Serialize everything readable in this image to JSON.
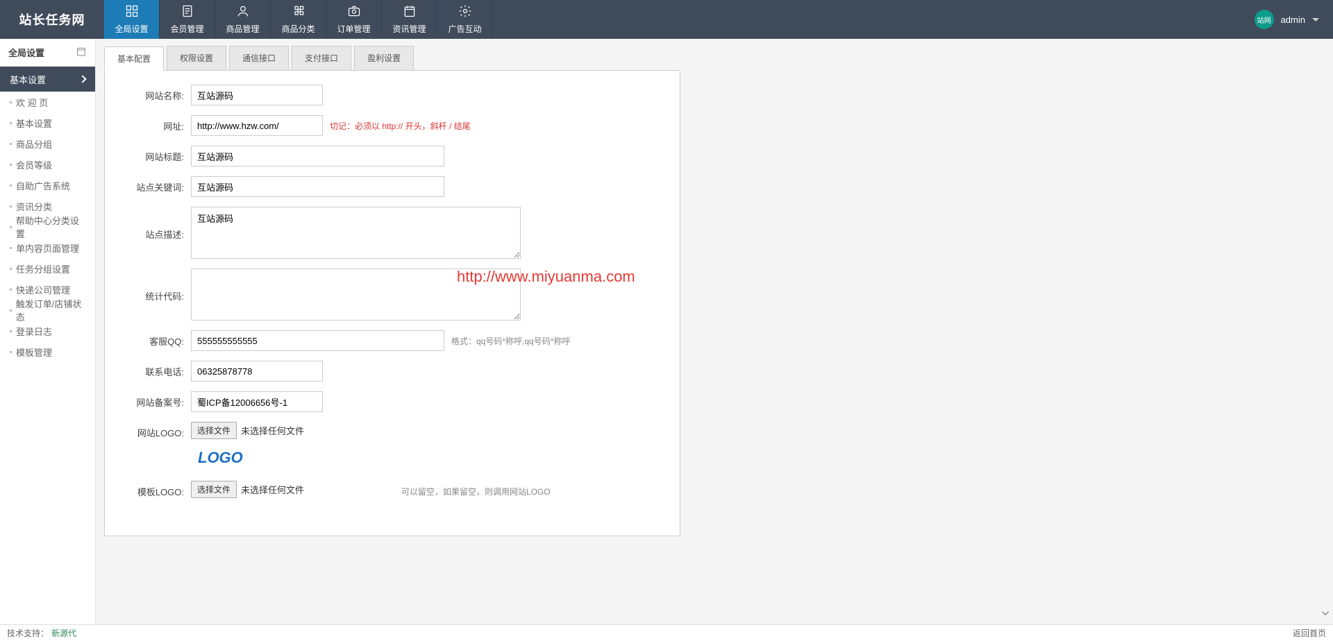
{
  "brand": "站长任务网",
  "topnav": [
    {
      "label": "全局设置",
      "icon": "grid"
    },
    {
      "label": "会员管理",
      "icon": "file"
    },
    {
      "label": "商品管理",
      "icon": "user"
    },
    {
      "label": "商品分类",
      "icon": "puzzle"
    },
    {
      "label": "订单管理",
      "icon": "camera"
    },
    {
      "label": "资讯管理",
      "icon": "calendar"
    },
    {
      "label": "广告互动",
      "icon": "gear"
    }
  ],
  "user": {
    "name": "admin",
    "avatar_text": "站网"
  },
  "side": {
    "title": "全局设置",
    "section": "基本设置",
    "items": [
      "欢 迎 页",
      "基本设置",
      "商品分组",
      "会员等级",
      "自助广告系统",
      "资讯分类",
      "帮助中心分类设置",
      "单内容页面管理",
      "任务分组设置",
      "快递公司管理",
      "触发订单/店铺状态",
      "登录日志",
      "模板管理"
    ]
  },
  "tabs": [
    "基本配置",
    "权限设置",
    "通信接口",
    "支付接口",
    "盈利设置"
  ],
  "active_tab": 0,
  "form": {
    "site_name": {
      "label": "网站名称:",
      "value": "互站源码"
    },
    "url": {
      "label": "网址:",
      "value": "http://www.hzw.com/",
      "hint": "切记：必须以 http:// 开头，斜杆 / 结尾"
    },
    "title": {
      "label": "网站标题:",
      "value": "互站源码"
    },
    "keywords": {
      "label": "站点关键词:",
      "value": "互站源码"
    },
    "description": {
      "label": "站点描述:",
      "value": "互站源码"
    },
    "stats_code": {
      "label": "统计代码:",
      "value": ""
    },
    "service_qq": {
      "label": "客服QQ:",
      "value": "555555555555",
      "hint": "格式：qq号码*称呼,qq号码*称呼"
    },
    "phone": {
      "label": "联系电话:",
      "value": "06325878778"
    },
    "icp": {
      "label": "网站备案号:",
      "value": "蜀ICP备12006656号-1"
    },
    "site_logo": {
      "label": "网站LOGO:",
      "file_btn": "选择文件",
      "file_status": "未选择任何文件"
    },
    "logo_preview": "LOGO",
    "template_logo": {
      "label": "模板LOGO:",
      "file_btn": "选择文件",
      "file_status": "未选择任何文件",
      "hint": "可以留空，如果留空，则调用网站LOGO"
    }
  },
  "watermark": "http://www.miyuanma.com",
  "footer": {
    "left": "技术支持：",
    "link": "新源代",
    "right": "返回首页"
  }
}
